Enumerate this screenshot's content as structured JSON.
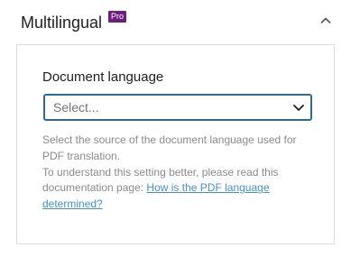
{
  "panel": {
    "title": "Multilingual",
    "badge": "Pro",
    "toggle_icon": "chevron-up-icon"
  },
  "field": {
    "label": "Document language",
    "select_value": "Select...",
    "select_icon": "chevron-down-icon"
  },
  "help": {
    "line1": "Select the source of the document language used for PDF translation.",
    "line2_prefix": "To understand this setting better, please read this documentation page: ",
    "link_text": "How is the PDF language determined?"
  },
  "colors": {
    "badge_bg": "#6d1f80",
    "select_border": "#2f6a8e",
    "link": "#4a8fc2",
    "help_text": "#8a8a8a"
  }
}
